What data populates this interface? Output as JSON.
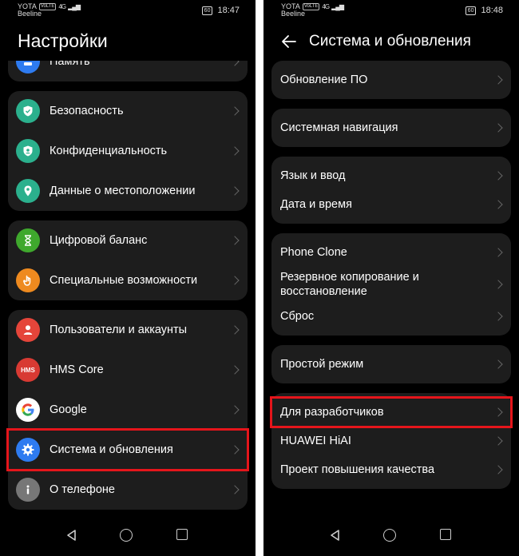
{
  "left": {
    "status": {
      "operator": "YOTA",
      "volte": "VoLTE",
      "network": "4G",
      "carrier2": "Beeline",
      "battery": "60",
      "time": "18:47"
    },
    "title": "Настройки",
    "partial_item": "Память",
    "groups": [
      [
        {
          "id": "security",
          "label": "Безопасность",
          "icon": "shield-icon",
          "color": "#2bb08d"
        },
        {
          "id": "privacy",
          "label": "Конфиденциальность",
          "icon": "privacy-icon",
          "color": "#2bb08d"
        },
        {
          "id": "location",
          "label": "Данные о местоположении",
          "icon": "location-pin-icon",
          "color": "#2bb08d"
        }
      ],
      [
        {
          "id": "digital-balance",
          "label": "Цифровой баланс",
          "icon": "hourglass-icon",
          "color": "#3fa82d"
        },
        {
          "id": "accessibility",
          "label": "Специальные возможности",
          "icon": "hand-icon",
          "color": "#ee8a1f"
        }
      ],
      [
        {
          "id": "users",
          "label": "Пользователи и аккаунты",
          "icon": "user-icon",
          "color": "#e5453a"
        },
        {
          "id": "hms-core",
          "label": "HMS Core",
          "icon": "hms-icon",
          "color": "#d83a33",
          "icon_text": "HMS"
        },
        {
          "id": "google",
          "label": "Google",
          "icon": "google-icon",
          "color": "#ffffff"
        },
        {
          "id": "system",
          "label": "Система и обновления",
          "icon": "gear-icon",
          "color": "#2e7bf0"
        },
        {
          "id": "about",
          "label": "О телефоне",
          "icon": "info-icon",
          "color": "#777777"
        }
      ]
    ]
  },
  "right": {
    "status": {
      "operator": "YOTA",
      "volte": "VoLTE",
      "network": "4G",
      "carrier2": "Beeline",
      "battery": "60",
      "time": "18:48"
    },
    "title": "Система и обновления",
    "groups": [
      [
        {
          "id": "software-update",
          "label": "Обновление ПО"
        }
      ],
      [
        {
          "id": "system-navigation",
          "label": "Системная навигация"
        }
      ],
      [
        {
          "id": "language-input",
          "label": "Язык и ввод"
        },
        {
          "id": "date-time",
          "label": "Дата и время"
        }
      ],
      [
        {
          "id": "phone-clone",
          "label": "Phone Clone"
        },
        {
          "id": "backup-restore",
          "label": "Резервное копирование и восстановление"
        },
        {
          "id": "reset",
          "label": "Сброс"
        }
      ],
      [
        {
          "id": "simple-mode",
          "label": "Простой режим"
        }
      ],
      [
        {
          "id": "developer-options",
          "label": "Для разработчиков"
        },
        {
          "id": "huawei-hiai",
          "label": "HUAWEI HiAI"
        },
        {
          "id": "quality-program",
          "label": "Проект повышения качества"
        }
      ]
    ]
  },
  "colors": {
    "highlight": "#e5151b",
    "card": "#1d1d1d",
    "background": "#000000"
  }
}
